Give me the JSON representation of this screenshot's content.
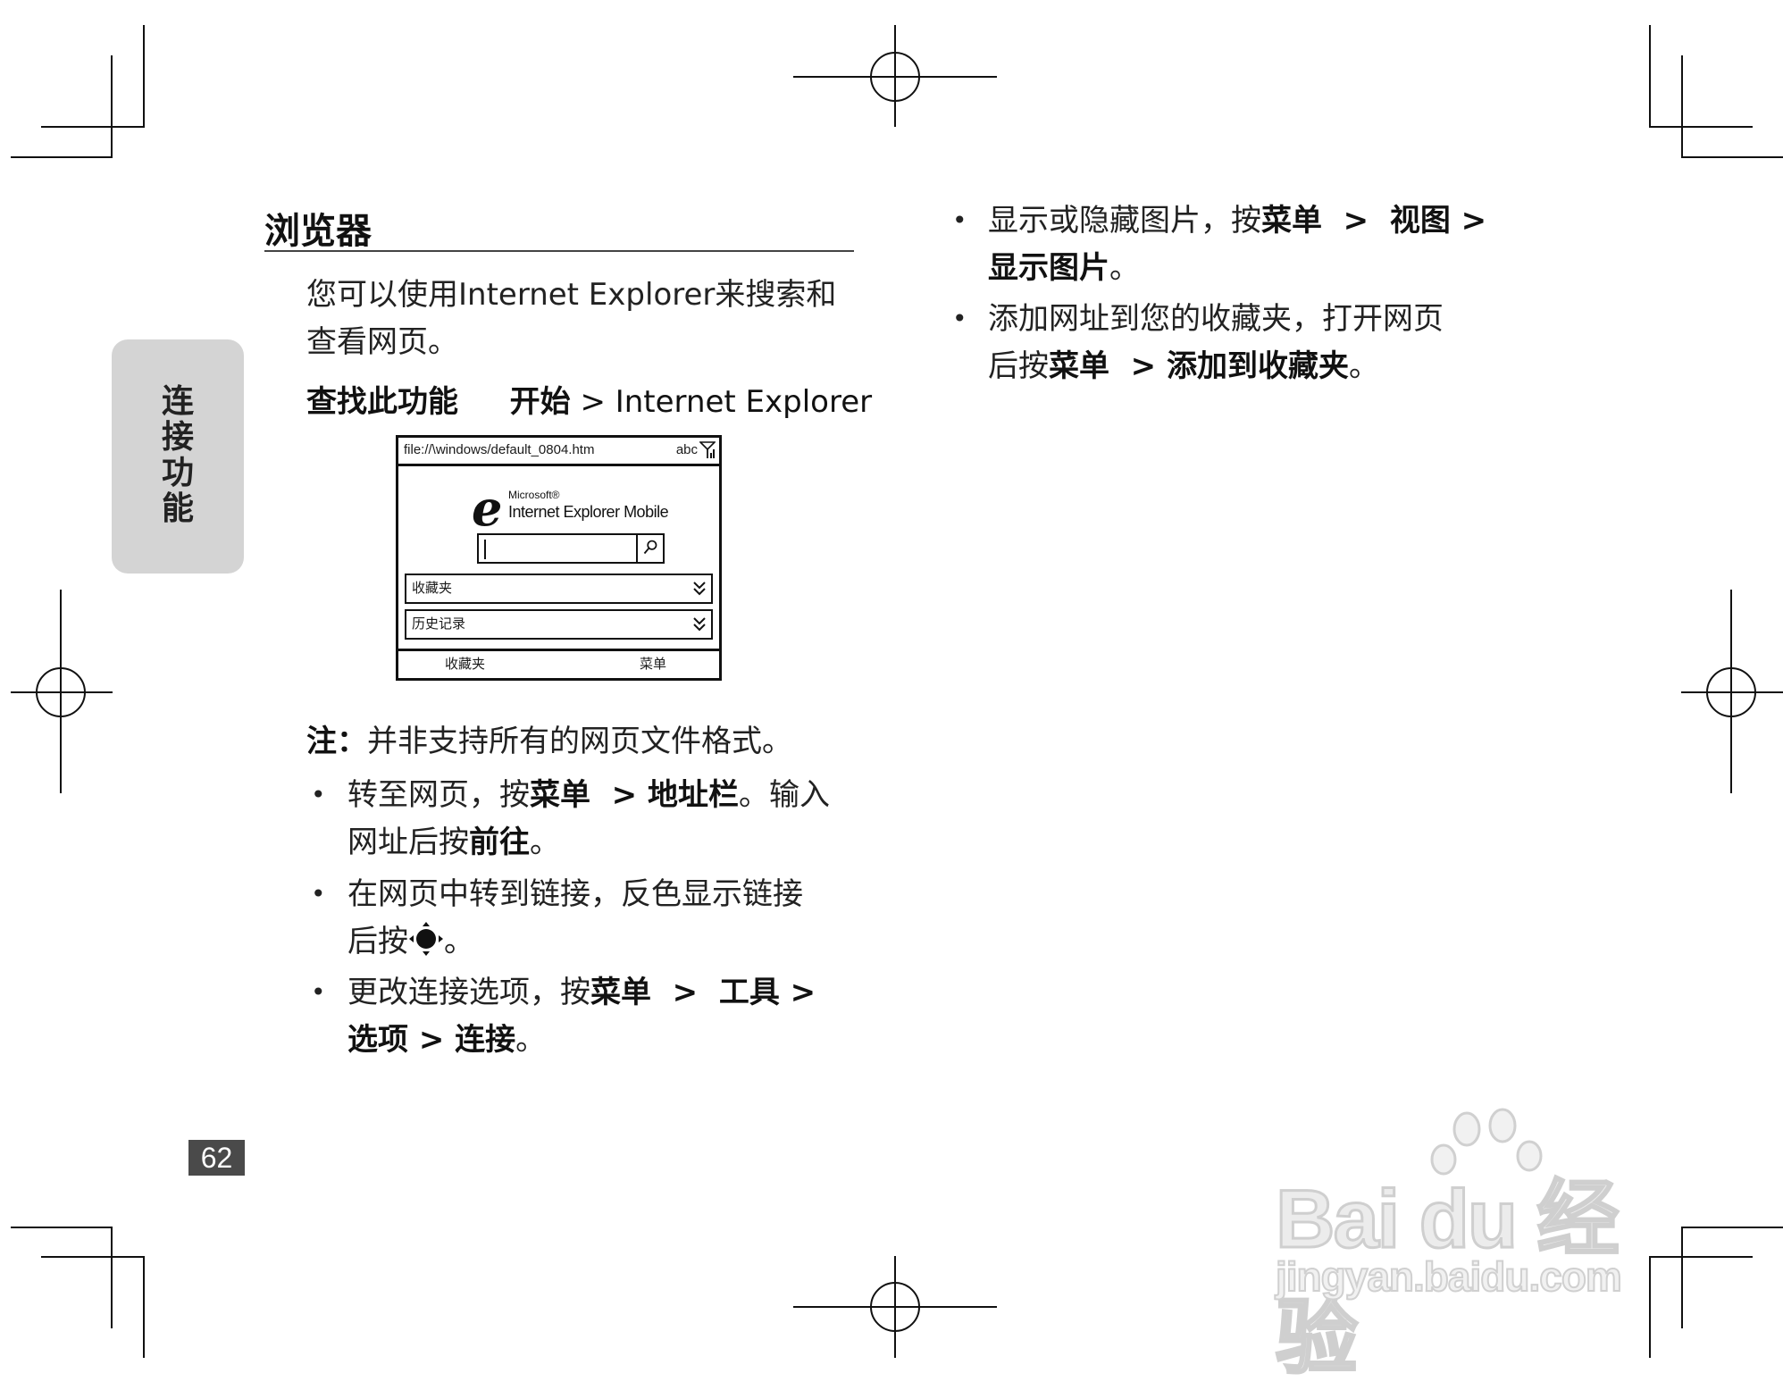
{
  "side_tab": {
    "label": "连\n接\n功\n能"
  },
  "section": {
    "heading": "浏览器",
    "intro": "您可以使用Internet Explorer来搜索和查看网页。",
    "find_label": "查找此功能",
    "find_path_bold": "开始",
    "find_path_rest": " > Internet Explorer"
  },
  "phone": {
    "url": "file://\\windows/default_0804.htm",
    "status": "abc",
    "brand_small": "Microsoft®",
    "brand_name": "Internet Explorer Mobile",
    "dropdown_favorites": "收藏夹",
    "dropdown_history": "历史记录",
    "soft_left": "收藏夹",
    "soft_right": "菜单"
  },
  "note": {
    "label": "注：",
    "text": "并非支持所有的网页文件格式。"
  },
  "left_bullets": {
    "b1": {
      "t1": "转至网页，按",
      "t2": "菜单",
      "t3": "  > ",
      "t4": "地址栏",
      "t5": "。输入",
      "t6": "网址后按",
      "t7": "前往",
      "t8": "。"
    },
    "b2": {
      "t1": "在网页中转到链接，反色显示链接",
      "t2": "后按",
      "t3": "。"
    },
    "b3": {
      "t1": "更改连接选项，按",
      "t2": "菜单",
      "t3": "  >  ",
      "t4": "工具",
      "t5": " >",
      "t6": "选项",
      "t7": " > ",
      "t8": "连接",
      "t9": "。"
    }
  },
  "right_bullets": {
    "b1": {
      "t1": "显示或隐藏图片，按",
      "t2": "菜单",
      "t3": "  >  ",
      "t4": "视图",
      "t5": " >",
      "t6": "显示图片",
      "t7": "。"
    },
    "b2": {
      "t1": "添加网址到您的收藏夹，打开网页",
      "t2": "后按",
      "t3": "菜单",
      "t4": "  > ",
      "t5": "添加到收藏夹",
      "t6": "。"
    }
  },
  "bullet_char": "•",
  "page_number": "62",
  "watermark": {
    "main": "Bai du 经验",
    "sub": "jingyan.baidu.com"
  },
  "icons": {
    "nav": "navigation-pad-icon",
    "search": "search-icon",
    "dropdown": "double-chevron-down-icon",
    "signal": "signal-icon"
  }
}
